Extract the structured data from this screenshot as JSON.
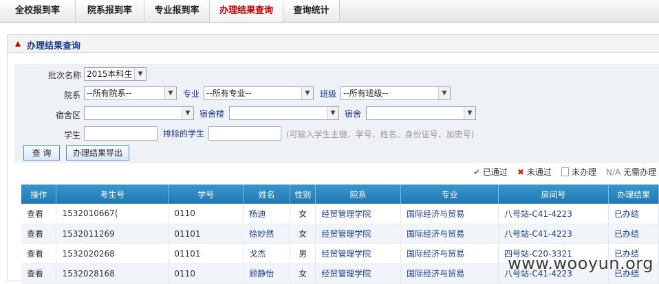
{
  "tabs": [
    "全校报到率",
    "院系报到率",
    "专业报到率",
    "办理结果查询",
    "查询统计"
  ],
  "panel_title": "办理结果查询",
  "filters": {
    "batch_label": "批次名称",
    "batch_value": "2015本科生",
    "dept_label": "院系",
    "dept_value": "--所有院系--",
    "major_label": "专业",
    "major_value": "--所有专业--",
    "class_label": "班级",
    "class_value": "--所有班级--",
    "dorm_area_label": "宿舍区",
    "dorm_area_value": "",
    "dorm_bldg_label": "宿舍楼",
    "dorm_bldg_value": "",
    "dorm_label": "宿舍",
    "dorm_value": "",
    "student_label": "学生",
    "exclude_label": "排除的学生",
    "hint": "(可输入学生主键、学号、姓名、身份证号、加密号)"
  },
  "buttons": {
    "query": "查 询",
    "export": "办理结果导出"
  },
  "legend": {
    "passed": "已通过",
    "failed": "未通过",
    "pending": "未办理",
    "na_mark": "N/A",
    "na": "无需办理"
  },
  "table": {
    "headers": [
      "操作",
      "考生号",
      "学号",
      "姓名",
      "性别",
      "院系",
      "专业",
      "房间号",
      "办理结果"
    ],
    "rows": [
      [
        "查看",
        "1532010667(",
        "0110",
        "杨迪",
        "女",
        "经贸管理学院",
        "国际经济与贸易",
        "八号站-C41-4223",
        "已办结"
      ],
      [
        "查看",
        "1532011269",
        "01101",
        "徐妙然",
        "女",
        "经贸管理学院",
        "国际经济与贸易",
        "八号站-C41-4223",
        "已办结"
      ],
      [
        "查看",
        "1532020268",
        "01101",
        "戈杰",
        "男",
        "经贸管理学院",
        "国际经济与贸易",
        "四号站-C20-3321",
        "已办结"
      ],
      [
        "查看",
        "1532028168",
        "0110",
        "顾静怡",
        "女",
        "经贸管理学院",
        "国际经济与贸易",
        "八号站-C41-4223",
        "已办结"
      ]
    ]
  },
  "watermark": "www.wooyun.org",
  "colors": {
    "active_tab": "#c00000",
    "header_blue": "#1f78b4",
    "title_blue": "#1a3a8c"
  }
}
